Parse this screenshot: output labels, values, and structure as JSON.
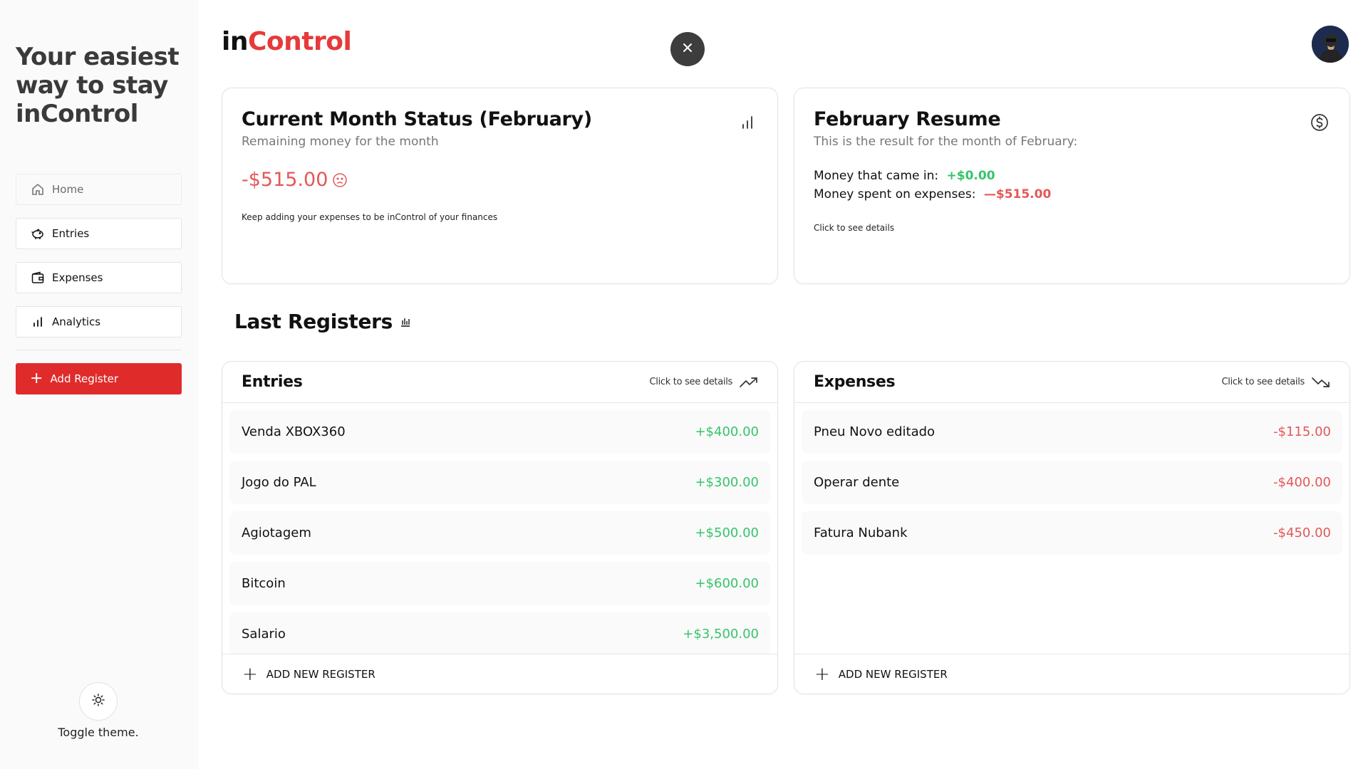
{
  "sidebar": {
    "tagline": "Your easiest way to stay inControl",
    "nav": [
      {
        "label": "Home",
        "icon": "home-icon"
      },
      {
        "label": "Entries",
        "icon": "piggy-bank-icon"
      },
      {
        "label": "Expenses",
        "icon": "wallet-icon"
      },
      {
        "label": "Analytics",
        "icon": "bar-chart-icon"
      }
    ],
    "add_register_label": "Add Register",
    "theme_label": "Toggle theme."
  },
  "header": {
    "brand_prefix": "in",
    "brand_suffix": "Control"
  },
  "status_card": {
    "title": "Current Month Status (February)",
    "subtitle": "Remaining money for the month",
    "amount": "-$515.00",
    "hint": "Keep adding your expenses to be inControl of your finances"
  },
  "resume_card": {
    "title": "February Resume",
    "subtitle": "This is the result for the month of February:",
    "income_label": "Money that came in:",
    "income_value": "+$0.00",
    "expense_label": "Money spent on expenses:",
    "expense_value": "—$515.00",
    "details": "Click to see details"
  },
  "last_registers": {
    "title": "Last Registers"
  },
  "entries": {
    "title": "Entries",
    "details": "Click to see details",
    "add_label": "ADD NEW REGISTER",
    "rows": [
      {
        "name": "Venda XBOX360",
        "amount": "+$400.00"
      },
      {
        "name": "Jogo do PAL",
        "amount": "+$300.00"
      },
      {
        "name": "Agiotagem",
        "amount": "+$500.00"
      },
      {
        "name": "Bitcoin",
        "amount": "+$600.00"
      },
      {
        "name": "Salario",
        "amount": "+$3,500.00"
      }
    ]
  },
  "expenses": {
    "title": "Expenses",
    "details": "Click to see details",
    "add_label": "ADD NEW REGISTER",
    "rows": [
      {
        "name": "Pneu Novo editado",
        "amount": "-$115.00"
      },
      {
        "name": "Operar dente",
        "amount": "-$400.00"
      },
      {
        "name": "Fatura Nubank",
        "amount": "-$450.00"
      }
    ]
  },
  "colors": {
    "accent_red": "#e02b2b",
    "positive": "#36c46a",
    "negative": "#e45757"
  }
}
